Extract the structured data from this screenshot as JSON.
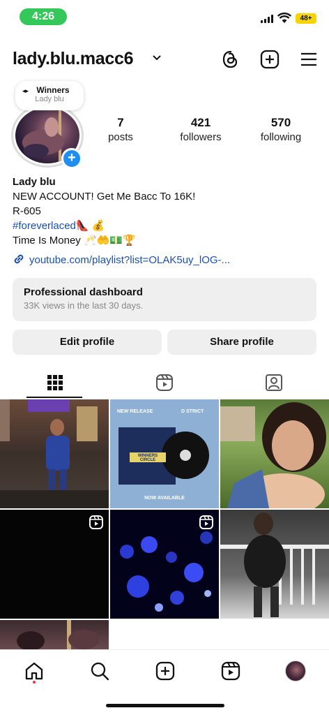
{
  "status": {
    "time": "4:26",
    "battery": "48+"
  },
  "header": {
    "username": "lady.blu.macc6"
  },
  "note": {
    "title": "Winners",
    "subtitle": "Lady blu"
  },
  "stats": [
    {
      "value": "7",
      "label": "posts"
    },
    {
      "value": "421",
      "label": "followers"
    },
    {
      "value": "570",
      "label": "following"
    }
  ],
  "bio": {
    "name": "Lady blu",
    "line1": "NEW ACCOUNT! Get Me Bacc To 16K!",
    "line2": "R-605",
    "hashtag": "#foreverlaced",
    "hashtag_emoji": "👠 💰",
    "line4": "Time Is Money 🥂🤲💵🏆",
    "link": "youtube.com/playlist?list=OLAK5uy_lOG-..."
  },
  "dashboard": {
    "title": "Professional dashboard",
    "subtitle": "33K views in the last 30 days."
  },
  "buttons": {
    "edit": "Edit profile",
    "share": "Share profile"
  },
  "grid_tiles": {
    "album_top_left": "NEW RELEASE",
    "album_top_right": "D STRICT",
    "album_center": "WINNERS CIRCLE",
    "album_bottom": "NOW AVAILABLE"
  },
  "colors": {
    "link": "#1a4fb5",
    "accent": "#1f8ef1",
    "status_green": "#34c759"
  }
}
